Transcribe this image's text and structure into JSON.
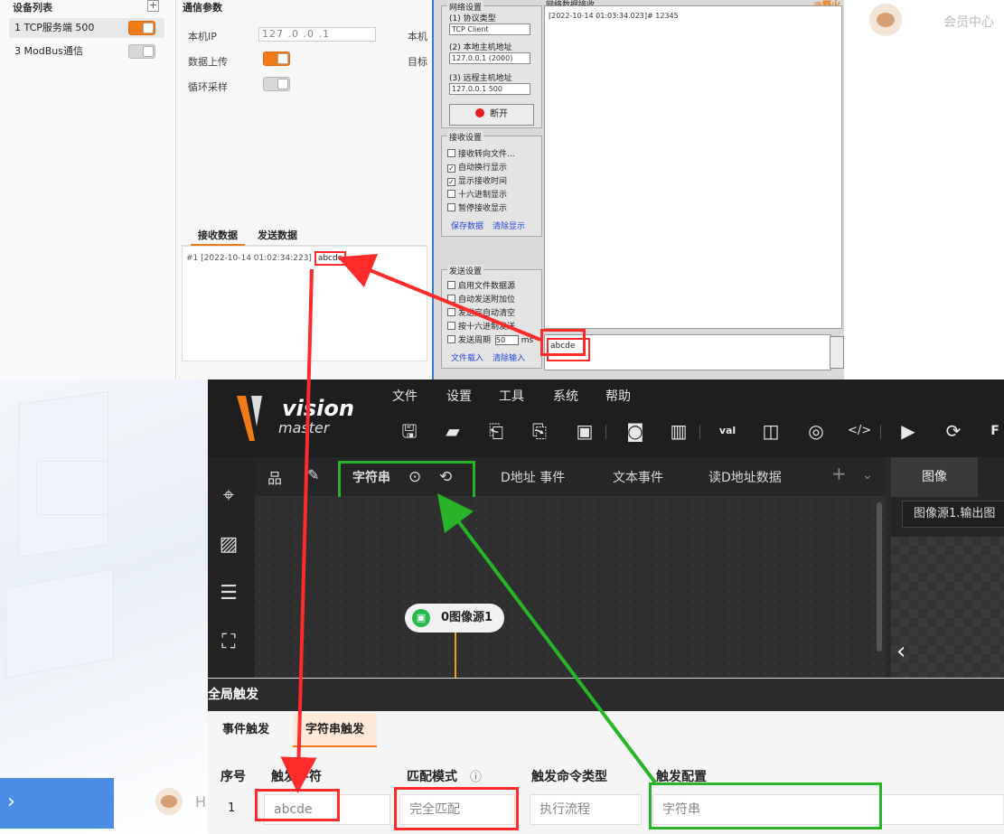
{
  "device_panel": {
    "title": "设备列表",
    "plus_icon": "plus-icon",
    "items": [
      {
        "label": "1 TCP服务端 500",
        "state": "on"
      },
      {
        "label": "3 ModBus通信",
        "state": "off"
      }
    ]
  },
  "params_panel": {
    "title": "通信参数",
    "local_ip_label": "本机IP",
    "local_ip_value": "127 .0 .0 .1",
    "right_label_1": "本机",
    "upload_label": "数据上传",
    "right_label_2": "目标",
    "loop_label": "循环采样",
    "tabs": [
      "接收数据",
      "发送数据"
    ],
    "recv_prefix": "#1 [2022-10-14  01:02:34:223]",
    "recv_data": "abcde"
  },
  "net_assist": {
    "brand": "@野火",
    "net_settings_title": "网络设置",
    "protocol_label": "(1) 协议类型",
    "protocol_value": "TCP Client",
    "local_host_label": "(2) 本地主机地址",
    "local_host_value": "127.0.0.1 (2000)",
    "remote_host_label": "(3) 远程主机地址",
    "remote_host_value": "127.0.0.1 500",
    "open_button": "断开",
    "recv_settings_title": "接收设置",
    "recv_options": [
      {
        "label": "接收转向文件...",
        "checked": false
      },
      {
        "label": "自动换行显示",
        "checked": true
      },
      {
        "label": "显示接收时间",
        "checked": true
      },
      {
        "label": "十六进制显示",
        "checked": false
      },
      {
        "label": "暂停接收显示",
        "checked": false
      }
    ],
    "recv_links": [
      "保存数据",
      "清除显示"
    ],
    "send_settings_title": "发送设置",
    "send_options": [
      {
        "label": "启用文件数据源",
        "checked": false
      },
      {
        "label": "自动发送附加位",
        "checked": false
      },
      {
        "label": "发送完自动清空",
        "checked": false
      },
      {
        "label": "按十六进制发送",
        "checked": false
      },
      {
        "label": "发送周期",
        "checked": false
      }
    ],
    "send_period_value": "50",
    "send_period_unit": "ms",
    "send_links": [
      "文件载入",
      "清除输入"
    ],
    "log_header": "网络数据接收",
    "log_text": "[2022-10-14 01:03:34.023]# 12345",
    "send_text": "abcde"
  },
  "member": {
    "label": "会员中心",
    "avatar_icon": "monkey-avatar-icon"
  },
  "deco": {
    "bottom_text": "H",
    "chevron": "›"
  },
  "vision_master": {
    "logo_vision": "vision",
    "logo_master": "master",
    "menu": [
      "文件",
      "设置",
      "工具",
      "系统",
      "帮助"
    ],
    "toolbar_icons": [
      "save-icon",
      "open-folder-icon",
      "undo-icon",
      "redo-icon",
      "lock-icon",
      "camera-icon",
      "tools-icon",
      "variable-icon",
      "io-icon",
      "global-icon",
      "script-icon",
      "run-once-icon",
      "run-loop-icon",
      "f-icon"
    ],
    "side_icons": [
      "crosshair-icon",
      "image-edit-icon",
      "list-icon",
      "focus-icon"
    ],
    "flow_tabs": [
      "字符串",
      "D地址 事件",
      "文本事件",
      "读D地址数据"
    ],
    "plus_tab": "+",
    "node_label": "0图像源1",
    "image_tab": "图像",
    "image_source": "图像源1.输出图",
    "trigger_title": "全局触发",
    "trigger_tabs": [
      "事件触发",
      "字符串触发"
    ],
    "columns": [
      "序号",
      "触发字符",
      "匹配模式",
      "触发命令类型",
      "触发配置"
    ],
    "row": {
      "index": "1",
      "trigger_char": "abcde",
      "match_mode": "完全匹配",
      "command_type": "执行流程",
      "config": "字符串"
    }
  },
  "colors": {
    "accent_orange": "#f07a15",
    "annotation_red": "#ff2a2a",
    "annotation_green": "#28b428"
  }
}
